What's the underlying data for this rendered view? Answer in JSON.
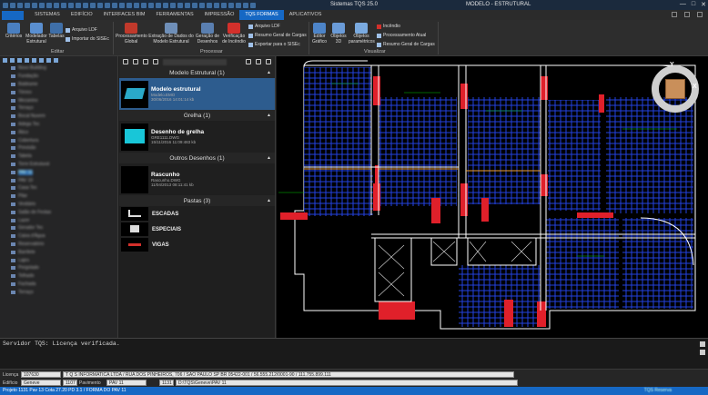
{
  "window": {
    "title": "Sistemas TQS 25.0",
    "context_title": "MODELO - ESTRUTURAL"
  },
  "tabs": [
    "SISTEMAS",
    "EDIFÍCIO",
    "INTERFACES BIM",
    "FERRAMENTAS",
    "IMPRESSÃO",
    "TQS FORMAS",
    "APLICATIVOS"
  ],
  "active_tab": "TQS FORMAS",
  "ribbon": {
    "editar": {
      "group_label": "Editar",
      "criterios": "Critérios",
      "modelador": "Modelador Estrutural",
      "tabelas": "Tabelas",
      "arquivo_ldf": "Arquivo LDF",
      "importar_sisec": "Importar do SISEc"
    },
    "processar": {
      "group_label": "Processar",
      "proc_global": "Processamento Global",
      "extracao": "Extração de Dados do Modelo Estrutural",
      "geracao": "Geração de Desenhos",
      "verificacao": "Verificação de Incêndio",
      "arquivo_ldf": "Arquivo LDF",
      "resumo_cargas": "Resumo Geral de Cargas",
      "exportar": "Exportar para o SISEc"
    },
    "visualizar": {
      "group_label": "Visualizar",
      "editor": "Editor Gráfico",
      "objetos3d": "Objetos 3D",
      "objetos_param": "Objetos paramétricos",
      "incendio": "Incêndio",
      "proc_atual": "Processamento Atual",
      "resumo_cargas": "Resumo Geral de Cargas"
    }
  },
  "tree_items": [
    "Novo Building",
    "Fundação",
    "Baldrame",
    "Térreo",
    "Mezanino",
    "Terraço",
    "Bocal Nuvem",
    "Adega Tec",
    "Ático",
    "Cobertura",
    "Previsão",
    "Tabela",
    "Torre Estrutural",
    "PAV 11",
    "PAV 10",
    "Casa Tec",
    "Pilar",
    "Vestiário",
    "Salão de Festas",
    "Lazer",
    "Gerador Tec",
    "Caixa d'Água",
    "Reservatório",
    "Barrilete",
    "Lajes",
    "Pergolado",
    "Telhado",
    "Fachada",
    "Terraço"
  ],
  "selected_tree_index": 13,
  "middle": {
    "sections": [
      {
        "title": "Modelo Estrutural (1)",
        "items": [
          {
            "name": "Modelo estrutural",
            "line1": "Modelo.EMO",
            "line2": "30/06/2016 14:01:14 kb"
          }
        ]
      },
      {
        "title": "Grelha (1)",
        "items": [
          {
            "name": "Desenho de grelha",
            "line1": "GRE1111.DWG",
            "line2": "15/11/2016 11:09:483 kb"
          }
        ]
      },
      {
        "title": "Outros Desenhos (1)",
        "items": [
          {
            "name": "Rascunho",
            "line1": "Rascunho.DWG",
            "line2": "11/04/2013 08:11:41 kb"
          }
        ]
      }
    ],
    "pastas": {
      "title": "Pastas (3)",
      "folders": [
        "ESCADAS",
        "ESPECIAIS",
        "VIGAS"
      ]
    }
  },
  "viewcube": {
    "x_label": "X",
    "y_label": "Y"
  },
  "console": {
    "line": "Servidor TQS: Licença verificada."
  },
  "info": {
    "licenca_label": "Licença",
    "licenca_value": "107630",
    "licenca_text": "T Q S INFORMATICA LTDA / RUA DOS PINHEIROS, 706 / SAO PAULO SP BR 05422-001 / 56.555.212/0001-90 / 111.755.899.111",
    "edificio_label": "Edifício",
    "edificio_value": "Geneve",
    "edificio_num": "1107",
    "pavimento_label": "Pavimento",
    "pavimento_value": "PAV 11",
    "pav_num": "1131",
    "path": "D:\\TQS\\Geneve\\PAV 11"
  },
  "status": {
    "left": "Projeto 1131 Pav 13 Cota  27.20 PD 3.1 / FORMA DO PAV 11",
    "right": "TQS Reserva"
  },
  "colors": {
    "accent": "#1668c4",
    "pillar": "#e0202a",
    "grid": "#1f3fd6",
    "wall": "#ffffff",
    "text_dim": "#00c800"
  }
}
